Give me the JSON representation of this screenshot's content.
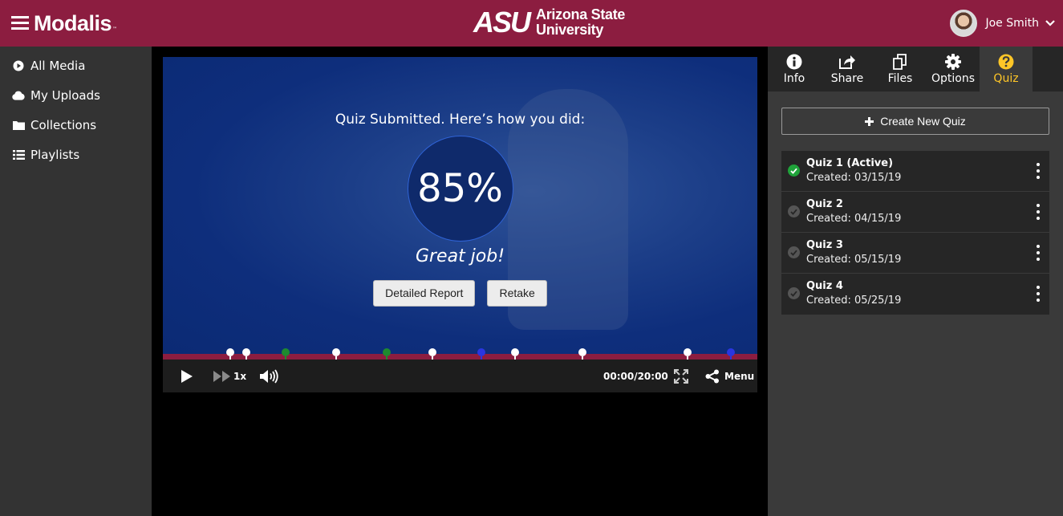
{
  "header": {
    "brand": "Modalis",
    "brand_tm": "™",
    "university_line1": "Arizona State",
    "university_line2": "University",
    "asu_mark": "ASU",
    "user_name": "Joe Smith",
    "colors": {
      "maroon": "#8c1d40",
      "gold": "#ffc627"
    }
  },
  "sidebar": {
    "items": [
      {
        "label": "All Media",
        "icon": "play-circle-icon"
      },
      {
        "label": "My Uploads",
        "icon": "cloud-icon"
      },
      {
        "label": "Collections",
        "icon": "folder-icon"
      },
      {
        "label": "Playlists",
        "icon": "list-icon"
      }
    ]
  },
  "player": {
    "quiz_title": "Quiz Submitted. Here’s how you did:",
    "score": "85%",
    "message": "Great job!",
    "report_button": "Detailed Report",
    "retake_button": "Retake",
    "speed": "1x",
    "time": "00:00/20:00",
    "menu": "Menu",
    "progress": 0,
    "markers": [
      {
        "position": 0.113,
        "color": "#ffffff"
      },
      {
        "position": 0.14,
        "color": "#ffffff"
      },
      {
        "position": 0.207,
        "color": "#1e8a2e"
      },
      {
        "position": 0.292,
        "color": "#ffffff"
      },
      {
        "position": 0.376,
        "color": "#1e8a2e"
      },
      {
        "position": 0.454,
        "color": "#ffffff"
      },
      {
        "position": 0.536,
        "color": "#2a36e0"
      },
      {
        "position": 0.593,
        "color": "#ffffff"
      },
      {
        "position": 0.706,
        "color": "#ffffff"
      },
      {
        "position": 0.882,
        "color": "#ffffff"
      },
      {
        "position": 0.956,
        "color": "#2a36e0"
      }
    ]
  },
  "panel": {
    "tabs": [
      {
        "label": "Info",
        "icon": "info-icon"
      },
      {
        "label": "Share",
        "icon": "share-icon"
      },
      {
        "label": "Files",
        "icon": "files-icon"
      },
      {
        "label": "Options",
        "icon": "gear-icon"
      },
      {
        "label": "Quiz",
        "icon": "question-icon",
        "active": true
      }
    ],
    "create_button": "Create New Quiz",
    "quizzes": [
      {
        "name": "Quiz 1 (Active)",
        "created": "Created: 03/15/19",
        "active": true
      },
      {
        "name": "Quiz 2",
        "created": "Created: 04/15/19",
        "active": false
      },
      {
        "name": "Quiz 3",
        "created": "Created: 05/15/19",
        "active": false
      },
      {
        "name": "Quiz 4",
        "created": "Created: 05/25/19",
        "active": false
      }
    ]
  }
}
